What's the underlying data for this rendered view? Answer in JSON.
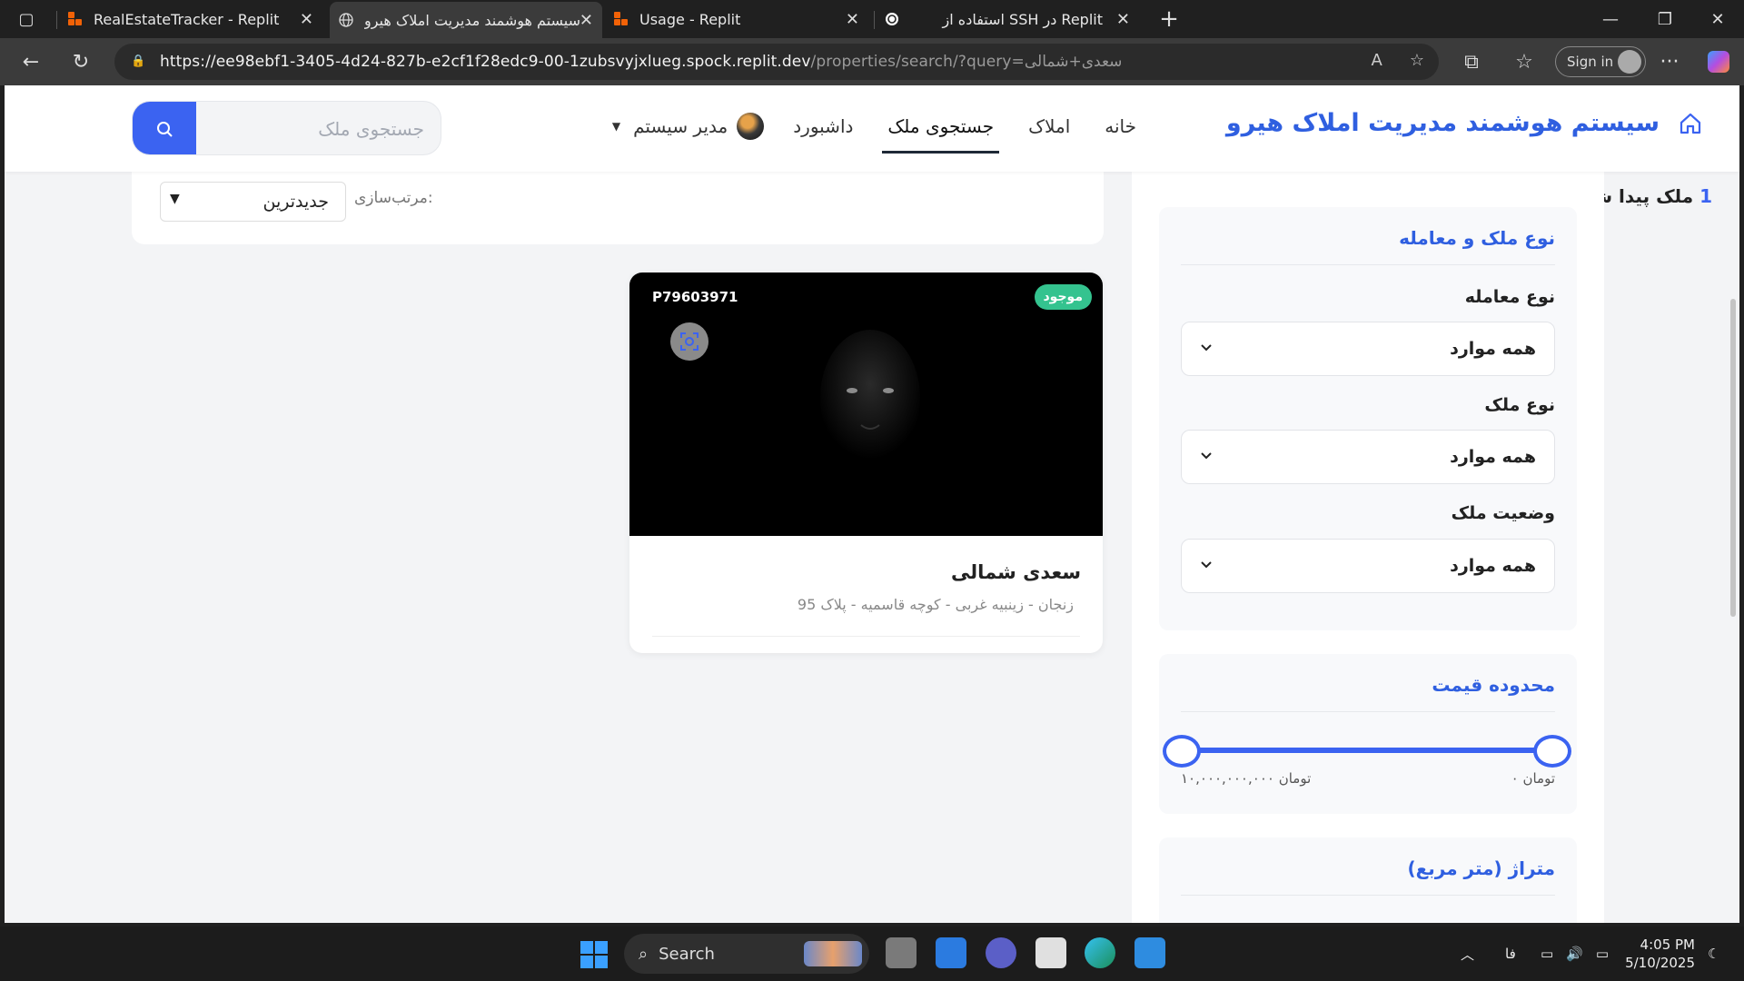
{
  "browser": {
    "tabs": [
      {
        "title": "RealEstateTracker - Replit",
        "favicon": "replit-icon",
        "active": false
      },
      {
        "title": "سیستم هوشمند مدیریت املاک هیرو",
        "favicon": "globe-icon",
        "active": true
      },
      {
        "title": "Usage - Replit",
        "favicon": "replit-icon",
        "active": false
      },
      {
        "title": "استفاده از SSH در Replit",
        "favicon": "openai-icon",
        "active": false
      }
    ],
    "url_host": "https://ee98ebf1-3405-4d24-827b-e2cf1f28edc9-00-1zubsvyjxlueg.spock.replit.dev",
    "url_path": "/properties/search/?query=سعدی+شمالی",
    "signin_label": "Sign in"
  },
  "site": {
    "brand_title": "سیستم هوشمند مدیریت املاک هیرو",
    "nav": {
      "home": "خانه",
      "properties": "املاک",
      "search": "جستجوی ملک",
      "dashboard": "داشبورد",
      "user": "مدیر سیستم"
    },
    "search_placeholder": "جستجوی ملک",
    "accent_color": "#3b63f1"
  },
  "results": {
    "count": "1",
    "count_text": "ملک پیدا شد",
    "sort_label": "مرتب‌سازی:",
    "sort_value": "جدیدترین"
  },
  "property": {
    "code": "P79603971",
    "status": "موجود",
    "title": "سعدی شمالی",
    "address": "زنجان - زینبیه غربی - کوچه قاسمیه - پلاک 95"
  },
  "filters": {
    "type_group_title": "نوع ملک و معامله",
    "deal_type_label": "نوع معامله",
    "deal_type_value": "همه موارد",
    "property_type_label": "نوع ملک",
    "property_type_value": "همه موارد",
    "status_label": "وضعیت ملک",
    "status_value": "همه موارد",
    "price_title": "محدوده قیمت",
    "price_min": "۰ تومان",
    "price_max": "۱۰,۰۰۰,۰۰۰,۰۰۰ تومان",
    "area_title": "متراژ (متر مربع)"
  },
  "taskbar": {
    "search_label": "Search",
    "lang": "فا",
    "time": "4:05 PM",
    "date": "5/10/2025"
  }
}
